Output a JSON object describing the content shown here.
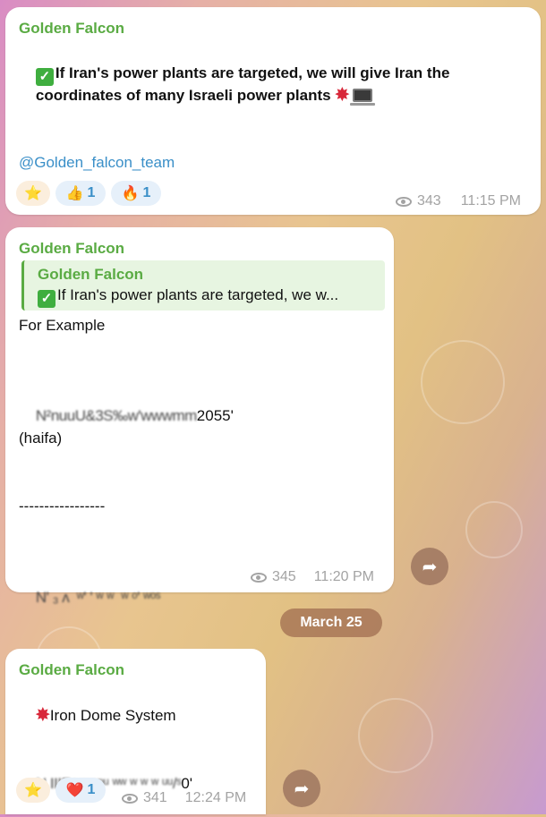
{
  "messages": [
    {
      "sender": "Golden Falcon",
      "text_line1": "If Iran's power plants are targeted, we will give Iran the",
      "text_line2": "coordinates of many Israeli power plants",
      "link": "@Golden_falcon_team",
      "reactions": [
        {
          "emoji": "⭐",
          "count": ""
        },
        {
          "emoji": "👍",
          "count": "1"
        },
        {
          "emoji": "🔥",
          "count": "1"
        }
      ],
      "views": "343",
      "time": "11:15 PM"
    },
    {
      "sender": "Golden Falcon",
      "reply": {
        "sender": "Golden Falcon",
        "text": "If Iran's power plants are targeted, we w..."
      },
      "lines": {
        "intro": "For Example",
        "coord1_blurred": "N²nuuU&3S‰w'wwwmm",
        "coord1_tail": "2055'",
        "city": "(haifa)",
        "separator": "-----------------",
        "coord2_blurred": "N' ₃ ʌ  ʷ' ' ʷ ʷ  ʷ ᵒ' ʷᵒˢ"
      },
      "views": "345",
      "time": "11:20 PM"
    },
    {
      "sender": "Golden Falcon",
      "title": "Iron Dome System",
      "coord_blurred": "N IIIRˢ ʷ ʷᵒᵘ ʷʷ ʷ ʷ ʷ ᵘᵘ/ˢ",
      "coord_tail": "0'",
      "reactions": [
        {
          "emoji": "⭐",
          "count": ""
        },
        {
          "emoji": "❤️",
          "count": "1"
        }
      ],
      "views": "341",
      "time": "12:24 PM"
    }
  ],
  "date_separator": "March 25",
  "icons": {
    "check": "✓",
    "anger": "💢",
    "forward": "➦"
  },
  "colors": {
    "sender": "#5aab43",
    "link": "#3a8fc8",
    "meta": "#a3a3a3"
  }
}
